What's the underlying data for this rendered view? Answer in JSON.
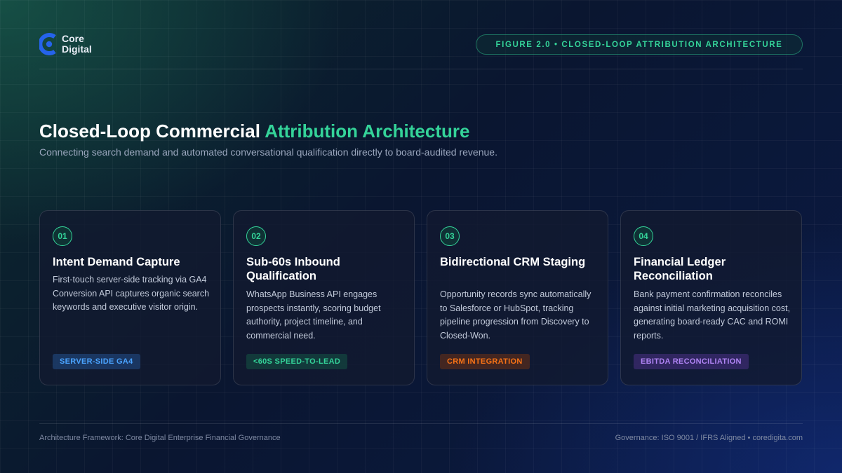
{
  "brand": {
    "name_line1": "Core",
    "name_line2": "Digital",
    "logo_icon": "core-digital-c-logo",
    "accent_color": "#34d399",
    "logo_color": "#2563eb"
  },
  "figure_label": "FIGURE 2.0 • CLOSED-LOOP ATTRIBUTION ARCHITECTURE",
  "title": {
    "main": "Closed-Loop Commercial ",
    "accent": "Attribution Architecture"
  },
  "subtitle": "Connecting search demand and automated conversational qualification directly to board-audited revenue.",
  "cards": [
    {
      "number": "01",
      "title": "Intent Demand Capture",
      "description": "First-touch server-side tracking via GA4 Conversion API captures organic search keywords and executive visitor origin.",
      "tag": "SERVER-SIDE GA4",
      "tag_color": "#4aa3ff"
    },
    {
      "number": "02",
      "title": "Sub-60s Inbound Qualification",
      "description": "WhatsApp Business API engages prospects instantly, scoring budget authority, project timeline, and commercial need.",
      "tag": "<60S SPEED-TO-LEAD",
      "tag_color": "#34d399"
    },
    {
      "number": "03",
      "title": "Bidirectional CRM Staging",
      "description": "Opportunity records sync automatically to Salesforce or HubSpot, tracking pipeline progression from Discovery to Closed-Won.",
      "tag": "CRM INTEGRATION",
      "tag_color": "#f97316"
    },
    {
      "number": "04",
      "title": "Financial Ledger Reconciliation",
      "description": "Bank payment confirmation reconciles against initial marketing acquisition cost, generating board-ready CAC and ROMI reports.",
      "tag": "EBITDA RECONCILIATION",
      "tag_color": "#b084f5"
    }
  ],
  "footer": {
    "left": "Architecture Framework: Core Digital Enterprise Financial Governance",
    "right": "Governance: ISO 9001 / IFRS Aligned • coredigita.com"
  }
}
